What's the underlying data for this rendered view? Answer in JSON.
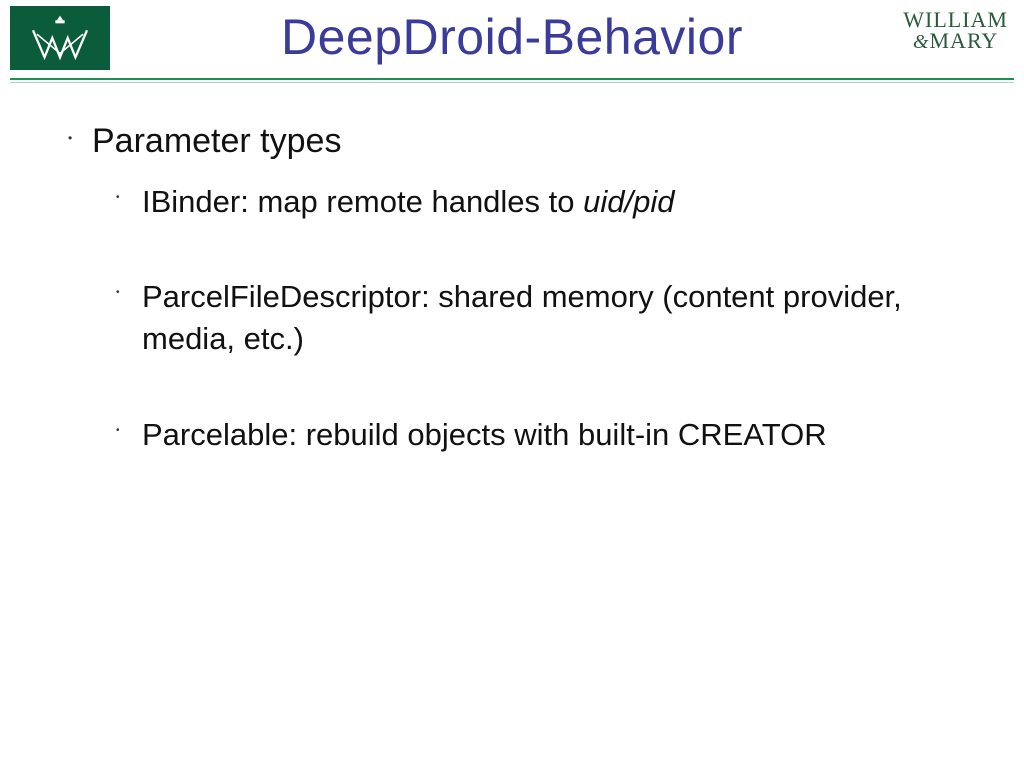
{
  "header": {
    "title": "DeepDroid-Behavior",
    "logo_right_line1": "WILLIAM",
    "logo_right_amp": "&",
    "logo_right_line2": "MARY"
  },
  "content": {
    "heading": "Parameter types",
    "items": [
      {
        "pre": "IBinder: map remote handles to ",
        "ital": "uid/pid",
        "post": ""
      },
      {
        "pre": "ParcelFileDescriptor: shared memory (content provider, media, etc.)",
        "ital": "",
        "post": ""
      },
      {
        "pre": "Parcelable: rebuild objects with built-in CREATOR",
        "ital": "",
        "post": ""
      }
    ]
  }
}
